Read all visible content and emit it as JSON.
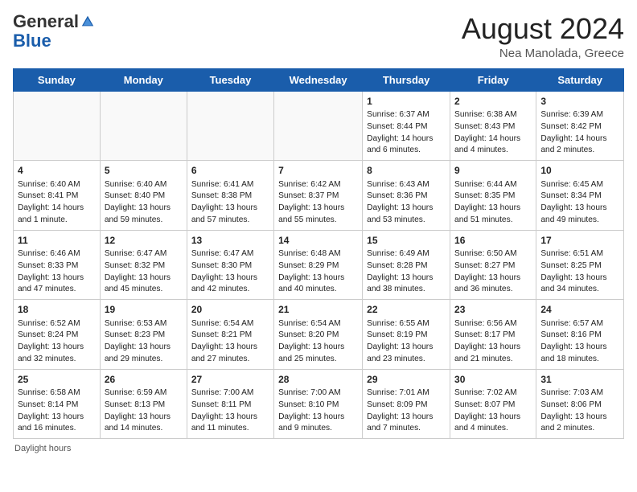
{
  "header": {
    "logo_general": "General",
    "logo_blue": "Blue",
    "month_year": "August 2024",
    "location": "Nea Manolada, Greece"
  },
  "weekdays": [
    "Sunday",
    "Monday",
    "Tuesday",
    "Wednesday",
    "Thursday",
    "Friday",
    "Saturday"
  ],
  "weeks": [
    [
      {
        "day": "",
        "sunrise": "",
        "sunset": "",
        "daylight": ""
      },
      {
        "day": "",
        "sunrise": "",
        "sunset": "",
        "daylight": ""
      },
      {
        "day": "",
        "sunrise": "",
        "sunset": "",
        "daylight": ""
      },
      {
        "day": "",
        "sunrise": "",
        "sunset": "",
        "daylight": ""
      },
      {
        "day": "1",
        "sunrise": "Sunrise: 6:37 AM",
        "sunset": "Sunset: 8:44 PM",
        "daylight": "Daylight: 14 hours and 6 minutes."
      },
      {
        "day": "2",
        "sunrise": "Sunrise: 6:38 AM",
        "sunset": "Sunset: 8:43 PM",
        "daylight": "Daylight: 14 hours and 4 minutes."
      },
      {
        "day": "3",
        "sunrise": "Sunrise: 6:39 AM",
        "sunset": "Sunset: 8:42 PM",
        "daylight": "Daylight: 14 hours and 2 minutes."
      }
    ],
    [
      {
        "day": "4",
        "sunrise": "Sunrise: 6:40 AM",
        "sunset": "Sunset: 8:41 PM",
        "daylight": "Daylight: 14 hours and 1 minute."
      },
      {
        "day": "5",
        "sunrise": "Sunrise: 6:40 AM",
        "sunset": "Sunset: 8:40 PM",
        "daylight": "Daylight: 13 hours and 59 minutes."
      },
      {
        "day": "6",
        "sunrise": "Sunrise: 6:41 AM",
        "sunset": "Sunset: 8:38 PM",
        "daylight": "Daylight: 13 hours and 57 minutes."
      },
      {
        "day": "7",
        "sunrise": "Sunrise: 6:42 AM",
        "sunset": "Sunset: 8:37 PM",
        "daylight": "Daylight: 13 hours and 55 minutes."
      },
      {
        "day": "8",
        "sunrise": "Sunrise: 6:43 AM",
        "sunset": "Sunset: 8:36 PM",
        "daylight": "Daylight: 13 hours and 53 minutes."
      },
      {
        "day": "9",
        "sunrise": "Sunrise: 6:44 AM",
        "sunset": "Sunset: 8:35 PM",
        "daylight": "Daylight: 13 hours and 51 minutes."
      },
      {
        "day": "10",
        "sunrise": "Sunrise: 6:45 AM",
        "sunset": "Sunset: 8:34 PM",
        "daylight": "Daylight: 13 hours and 49 minutes."
      }
    ],
    [
      {
        "day": "11",
        "sunrise": "Sunrise: 6:46 AM",
        "sunset": "Sunset: 8:33 PM",
        "daylight": "Daylight: 13 hours and 47 minutes."
      },
      {
        "day": "12",
        "sunrise": "Sunrise: 6:47 AM",
        "sunset": "Sunset: 8:32 PM",
        "daylight": "Daylight: 13 hours and 45 minutes."
      },
      {
        "day": "13",
        "sunrise": "Sunrise: 6:47 AM",
        "sunset": "Sunset: 8:30 PM",
        "daylight": "Daylight: 13 hours and 42 minutes."
      },
      {
        "day": "14",
        "sunrise": "Sunrise: 6:48 AM",
        "sunset": "Sunset: 8:29 PM",
        "daylight": "Daylight: 13 hours and 40 minutes."
      },
      {
        "day": "15",
        "sunrise": "Sunrise: 6:49 AM",
        "sunset": "Sunset: 8:28 PM",
        "daylight": "Daylight: 13 hours and 38 minutes."
      },
      {
        "day": "16",
        "sunrise": "Sunrise: 6:50 AM",
        "sunset": "Sunset: 8:27 PM",
        "daylight": "Daylight: 13 hours and 36 minutes."
      },
      {
        "day": "17",
        "sunrise": "Sunrise: 6:51 AM",
        "sunset": "Sunset: 8:25 PM",
        "daylight": "Daylight: 13 hours and 34 minutes."
      }
    ],
    [
      {
        "day": "18",
        "sunrise": "Sunrise: 6:52 AM",
        "sunset": "Sunset: 8:24 PM",
        "daylight": "Daylight: 13 hours and 32 minutes."
      },
      {
        "day": "19",
        "sunrise": "Sunrise: 6:53 AM",
        "sunset": "Sunset: 8:23 PM",
        "daylight": "Daylight: 13 hours and 29 minutes."
      },
      {
        "day": "20",
        "sunrise": "Sunrise: 6:54 AM",
        "sunset": "Sunset: 8:21 PM",
        "daylight": "Daylight: 13 hours and 27 minutes."
      },
      {
        "day": "21",
        "sunrise": "Sunrise: 6:54 AM",
        "sunset": "Sunset: 8:20 PM",
        "daylight": "Daylight: 13 hours and 25 minutes."
      },
      {
        "day": "22",
        "sunrise": "Sunrise: 6:55 AM",
        "sunset": "Sunset: 8:19 PM",
        "daylight": "Daylight: 13 hours and 23 minutes."
      },
      {
        "day": "23",
        "sunrise": "Sunrise: 6:56 AM",
        "sunset": "Sunset: 8:17 PM",
        "daylight": "Daylight: 13 hours and 21 minutes."
      },
      {
        "day": "24",
        "sunrise": "Sunrise: 6:57 AM",
        "sunset": "Sunset: 8:16 PM",
        "daylight": "Daylight: 13 hours and 18 minutes."
      }
    ],
    [
      {
        "day": "25",
        "sunrise": "Sunrise: 6:58 AM",
        "sunset": "Sunset: 8:14 PM",
        "daylight": "Daylight: 13 hours and 16 minutes."
      },
      {
        "day": "26",
        "sunrise": "Sunrise: 6:59 AM",
        "sunset": "Sunset: 8:13 PM",
        "daylight": "Daylight: 13 hours and 14 minutes."
      },
      {
        "day": "27",
        "sunrise": "Sunrise: 7:00 AM",
        "sunset": "Sunset: 8:11 PM",
        "daylight": "Daylight: 13 hours and 11 minutes."
      },
      {
        "day": "28",
        "sunrise": "Sunrise: 7:00 AM",
        "sunset": "Sunset: 8:10 PM",
        "daylight": "Daylight: 13 hours and 9 minutes."
      },
      {
        "day": "29",
        "sunrise": "Sunrise: 7:01 AM",
        "sunset": "Sunset: 8:09 PM",
        "daylight": "Daylight: 13 hours and 7 minutes."
      },
      {
        "day": "30",
        "sunrise": "Sunrise: 7:02 AM",
        "sunset": "Sunset: 8:07 PM",
        "daylight": "Daylight: 13 hours and 4 minutes."
      },
      {
        "day": "31",
        "sunrise": "Sunrise: 7:03 AM",
        "sunset": "Sunset: 8:06 PM",
        "daylight": "Daylight: 13 hours and 2 minutes."
      }
    ]
  ],
  "footer": {
    "daylight_label": "Daylight hours"
  }
}
